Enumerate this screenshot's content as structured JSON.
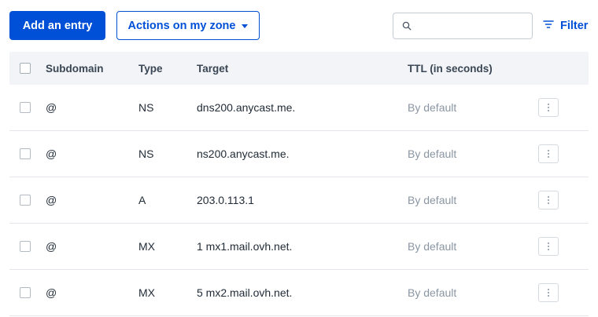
{
  "toolbar": {
    "add_entry_label": "Add an entry",
    "actions_label": "Actions on my zone",
    "search_placeholder": "",
    "filter_label": "Filter"
  },
  "colors": {
    "primary": "#0050d7",
    "header_bg": "#f2f4f7",
    "muted_text": "#8a96a3"
  },
  "table": {
    "columns": {
      "subdomain": "Subdomain",
      "type": "Type",
      "target": "Target",
      "ttl": "TTL (in seconds)"
    },
    "rows": [
      {
        "subdomain": "@",
        "type": "NS",
        "target": "dns200.anycast.me.",
        "ttl": "By default"
      },
      {
        "subdomain": "@",
        "type": "NS",
        "target": "ns200.anycast.me.",
        "ttl": "By default"
      },
      {
        "subdomain": "@",
        "type": "A",
        "target": "203.0.113.1",
        "ttl": "By default"
      },
      {
        "subdomain": "@",
        "type": "MX",
        "target": "1 mx1.mail.ovh.net.",
        "ttl": "By default"
      },
      {
        "subdomain": "@",
        "type": "MX",
        "target": "5 mx2.mail.ovh.net.",
        "ttl": "By default"
      }
    ]
  }
}
